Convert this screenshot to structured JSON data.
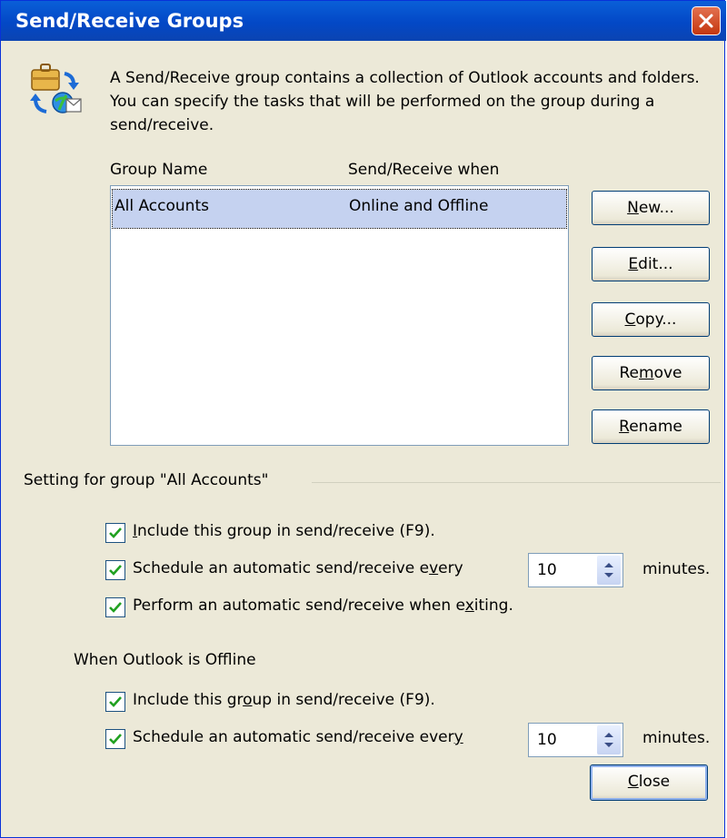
{
  "window": {
    "title": "Send/Receive Groups",
    "close_icon": "close-icon"
  },
  "intro": {
    "icon": "send-receive-icon",
    "text": "A Send/Receive group contains a collection of Outlook accounts and folders. You can specify the tasks that will be performed on the group during a send/receive."
  },
  "list": {
    "columns": [
      "Group Name",
      "Send/Receive when"
    ],
    "rows": [
      {
        "name": "All Accounts",
        "when": "Online and Offline",
        "selected": true
      }
    ]
  },
  "buttons": {
    "new": {
      "pre": "",
      "key": "N",
      "post": "ew..."
    },
    "edit": {
      "pre": "",
      "key": "E",
      "post": "dit..."
    },
    "copy": {
      "pre": "",
      "key": "C",
      "post": "opy..."
    },
    "remove": {
      "pre": "Re",
      "key": "m",
      "post": "ove"
    },
    "rename": {
      "pre": "",
      "key": "R",
      "post": "ename"
    },
    "close": {
      "pre": "",
      "key": "C",
      "post": "lose"
    }
  },
  "settings": {
    "group_label": "Setting for group \"All Accounts\"",
    "online": {
      "include": {
        "pre": "",
        "key": "I",
        "post": "nclude this group in send/receive (F9).",
        "checked": true
      },
      "schedule": {
        "pre": "Schedule an automatic send/receive e",
        "key": "v",
        "post": "ery",
        "checked": true,
        "value": "10",
        "unit": "minutes."
      },
      "exit": {
        "pre": "Perform an automatic send/receive when e",
        "key": "x",
        "post": "iting.",
        "checked": true
      }
    },
    "offline_label": "When Outlook is Offline",
    "offline": {
      "include": {
        "pre": "Include this gr",
        "key": "o",
        "post": "up in send/receive (F9).",
        "checked": true
      },
      "schedule": {
        "pre": "Schedule an automatic send/receive ever",
        "key": "y",
        "post": "",
        "checked": true,
        "value": "10",
        "unit": "minutes."
      }
    }
  }
}
